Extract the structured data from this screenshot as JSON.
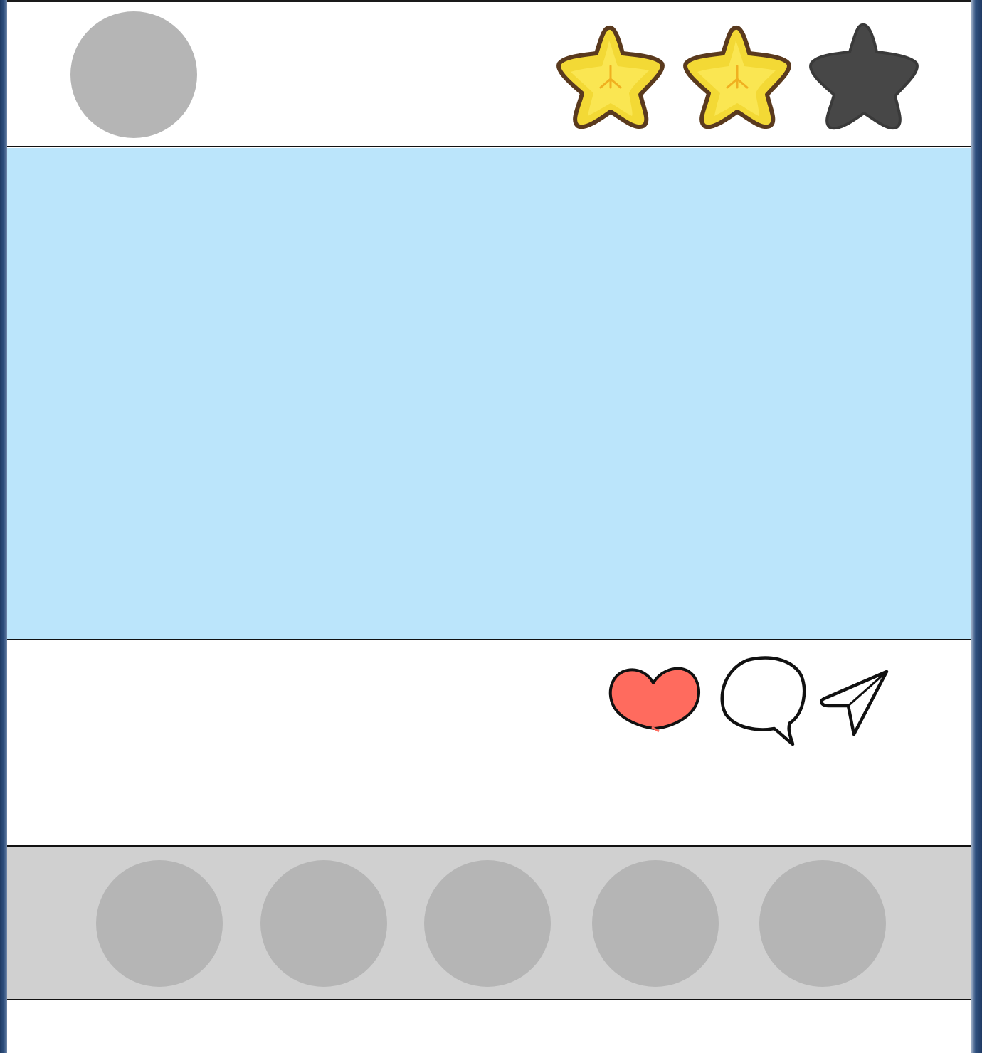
{
  "header": {
    "avatar": {
      "icon": "avatar-placeholder"
    },
    "rating": {
      "value": 2,
      "max": 3,
      "filled_color": "#f3d935",
      "empty_color": "#474747"
    }
  },
  "hero": {
    "color": "#bbe5fb"
  },
  "actions": {
    "like": {
      "icon": "heart-icon",
      "color": "#ff6b5e"
    },
    "comment": {
      "icon": "speech-bubble-icon"
    },
    "share": {
      "icon": "paper-plane-icon"
    }
  },
  "thumbnails": {
    "count": 5,
    "color": "#b5b5b5",
    "bar_color": "#d0d0d0"
  }
}
